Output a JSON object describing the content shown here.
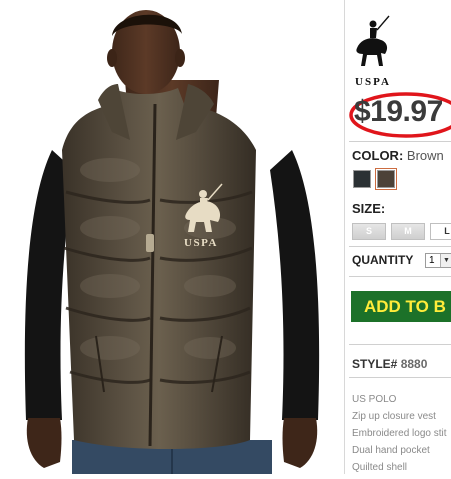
{
  "product": {
    "image_alt": "Brown quilted puffer vest with U.S. Polo Assn. logo",
    "chest_logo_text": "USPA"
  },
  "brand": {
    "logo_text": "USPA"
  },
  "price": {
    "value": "$19.97",
    "highlight_color": "#e0151b"
  },
  "color": {
    "label": "COLOR:",
    "selected": "Brown",
    "swatches": [
      {
        "name": "Black",
        "hex": "#2b3134"
      },
      {
        "name": "Brown",
        "hex": "#4c4238"
      }
    ]
  },
  "size": {
    "label": "SIZE:",
    "options": [
      "S",
      "M",
      "L"
    ]
  },
  "quantity": {
    "label": "QUANTITY",
    "value": "1"
  },
  "add_button": {
    "label": "ADD TO B",
    "bg": "#1c7129",
    "text_color": "#ffec3a"
  },
  "style": {
    "label": "STYLE#",
    "number": "8880"
  },
  "features": [
    "US POLO",
    "Zip up closure vest",
    "Embroidered logo stit",
    "Dual hand pocket",
    "Quilted shell"
  ]
}
